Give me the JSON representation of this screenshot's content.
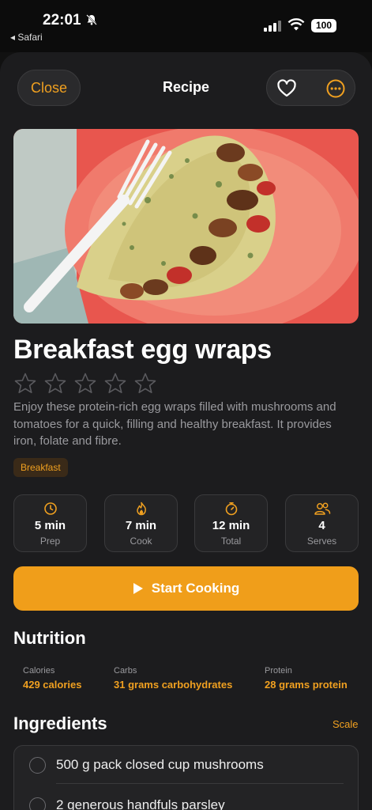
{
  "status": {
    "time": "22:01",
    "back_app": "◂ Safari",
    "battery": "100"
  },
  "nav": {
    "close_label": "Close",
    "title": "Recipe"
  },
  "recipe": {
    "title": "Breakfast egg wraps",
    "rating": 0,
    "max_rating": 5,
    "description": "Enjoy these protein-rich egg wraps filled with mushrooms and tomatoes for a quick, filling and healthy breakfast. It provides iron, folate and fibre.",
    "tag": "Breakfast"
  },
  "stats": [
    {
      "icon": "clock-icon",
      "value": "5 min",
      "label": "Prep"
    },
    {
      "icon": "flame-icon",
      "value": "7 min",
      "label": "Cook"
    },
    {
      "icon": "timer-icon",
      "value": "12 min",
      "label": "Total"
    },
    {
      "icon": "people-icon",
      "value": "4",
      "label": "Serves"
    }
  ],
  "start_button": "Start Cooking",
  "nutrition": {
    "heading": "Nutrition",
    "items": [
      {
        "label": "Calories",
        "value": "429 calories"
      },
      {
        "label": "Carbs",
        "value": "31 grams carbohydrates"
      },
      {
        "label": "Protein",
        "value": "28 grams protein"
      }
    ]
  },
  "ingredients": {
    "heading": "Ingredients",
    "scale_label": "Scale",
    "items": [
      "500 g pack closed cup mushrooms",
      "2 generous handfuls parsley"
    ]
  },
  "colors": {
    "accent": "#f0a020",
    "background": "#1c1c1e",
    "card": "#232325"
  }
}
